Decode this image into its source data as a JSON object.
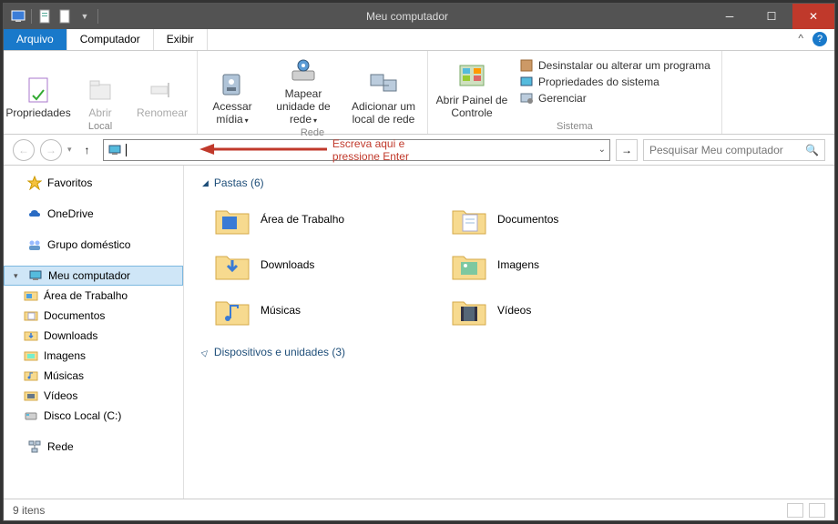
{
  "title": "Meu computador",
  "tabs": {
    "file": "Arquivo",
    "computer": "Computador",
    "view": "Exibir"
  },
  "ribbon": {
    "group1": {
      "name": "Local",
      "props": "Propriedades",
      "open": "Abrir",
      "rename": "Renomear"
    },
    "group2": {
      "name": "Rede",
      "accessMedia": "Acessar mídia",
      "mapDrive": "Mapear unidade de rede",
      "addLocation": "Adicionar um local de rede"
    },
    "group3": {
      "name": "Sistema",
      "openPanel": "Abrir Painel de Controle",
      "uninstall": "Desinstalar ou alterar um programa",
      "sysprops": "Propriedades do sistema",
      "manage": "Gerenciar"
    }
  },
  "annotation": "Escreva aqui e pressione Enter",
  "search_placeholder": "Pesquisar Meu computador",
  "nav": {
    "favorites": "Favoritos",
    "onedrive": "OneDrive",
    "homegroup": "Grupo doméstico",
    "thispc": "Meu computador",
    "desktop": "Área de Trabalho",
    "documents": "Documentos",
    "downloads": "Downloads",
    "pictures": "Imagens",
    "music": "Músicas",
    "videos": "Vídeos",
    "diskc": "Disco Local (C:)",
    "network": "Rede"
  },
  "sections": {
    "folders_title": "Pastas (6)",
    "devices_title": "Dispositivos e unidades (3)"
  },
  "folders": {
    "desktop": "Área de Trabalho",
    "documents": "Documentos",
    "downloads": "Downloads",
    "pictures": "Imagens",
    "music": "Músicas",
    "videos": "Vídeos"
  },
  "status": "9 itens"
}
